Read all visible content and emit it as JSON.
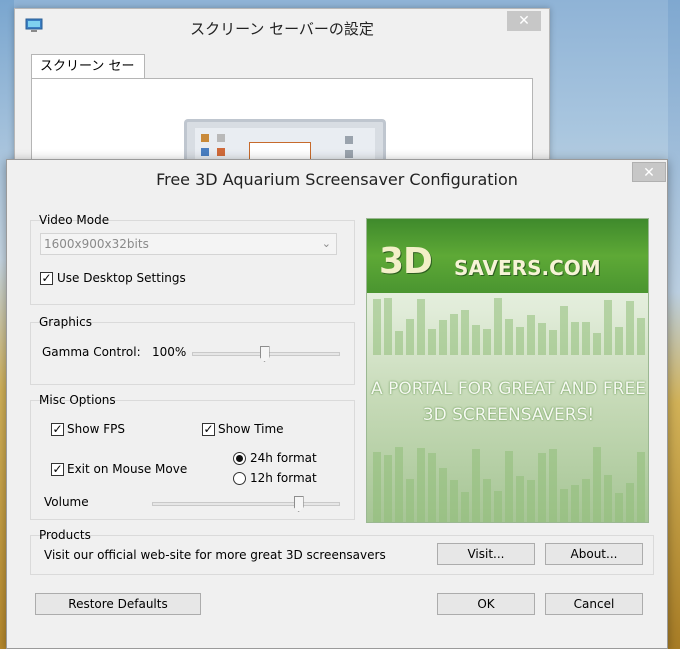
{
  "back_window": {
    "title": "スクリーン セーバーの設定",
    "close_glyph": "✕",
    "tab_label": "スクリーン セーバー"
  },
  "dialog": {
    "title": "Free 3D Aquarium Screensaver Configuration",
    "close_glyph": "✕",
    "video_mode": {
      "label": "Video Mode",
      "selected": "1600x900x32bits",
      "use_desktop_settings": "Use Desktop Settings",
      "use_desktop_checked": true
    },
    "graphics": {
      "label": "Graphics",
      "gamma_label": "Gamma Control:",
      "gamma_value": "100%",
      "gamma_level": 0.49
    },
    "misc": {
      "label": "Misc Options",
      "show_fps": "Show FPS",
      "show_fps_checked": true,
      "show_time": "Show Time",
      "show_time_checked": true,
      "exit_on_mouse_move": "Exit on Mouse Move",
      "exit_checked": true,
      "format_24h": "24h format",
      "format_12h": "12h format",
      "selected_format": "24h",
      "volume_label": "Volume",
      "volume_level": 0.78
    },
    "banner": {
      "brand_3d": "3D",
      "brand_rest": "SAVERS.COM",
      "tagline_1": "A PORTAL FOR GREAT AND FREE",
      "tagline_2": "3D SCREENSAVERS!"
    },
    "products": {
      "label": "Products",
      "text": "Visit our official web-site for more great 3D screensavers",
      "visit_button": "Visit...",
      "about_button": "About..."
    },
    "buttons": {
      "restore_defaults": "Restore Defaults",
      "ok": "OK",
      "cancel": "Cancel"
    },
    "colors": {
      "banner_green": "#4a9530",
      "brand_text": "#f3f0c8"
    }
  }
}
